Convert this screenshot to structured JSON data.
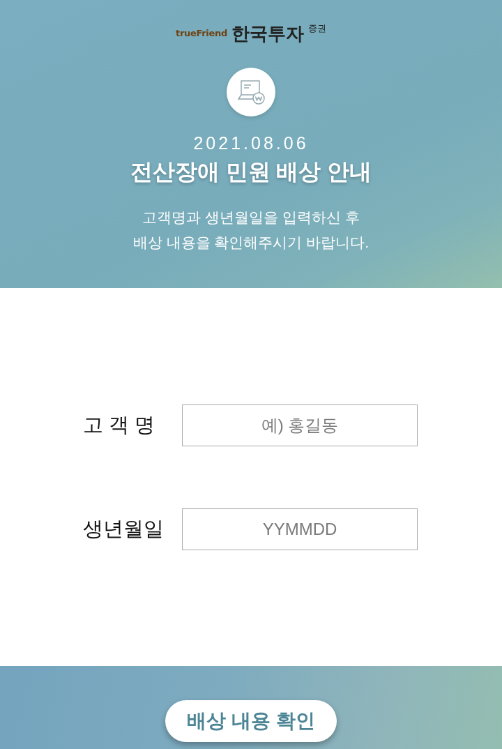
{
  "header": {
    "logo": {
      "brand_en": "trueFriend",
      "brand_ko": "한국투자",
      "brand_suffix": "증권"
    },
    "date": "2021.08.06",
    "title": "전산장애 민원 배상 안내",
    "description": [
      "고객명과 생년월일을 입력하신 후",
      "배상 내용을 확인해주시기 바랍니다."
    ]
  },
  "form": {
    "fields": [
      {
        "label": "고 객 명",
        "placeholder": "예) 홍길동"
      },
      {
        "label": "생년월일",
        "placeholder": "YYMMDD"
      }
    ]
  },
  "footer": {
    "button": "배상 내용 확인"
  }
}
